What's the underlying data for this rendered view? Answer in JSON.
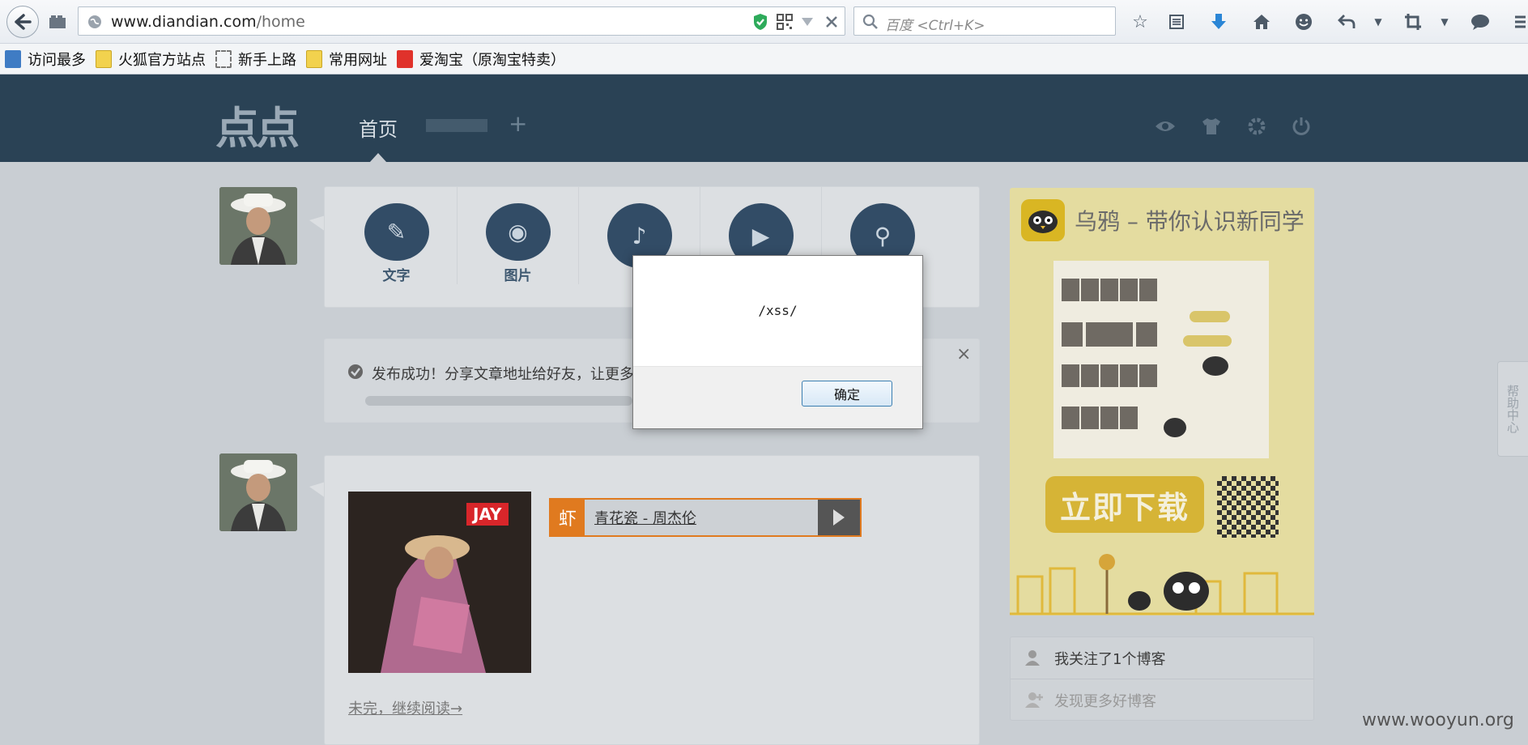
{
  "browser": {
    "url_host": "www.diandian.com",
    "url_path": "/home",
    "search_placeholder": "百度 <Ctrl+K>",
    "bookmarks": [
      {
        "label": "访问最多",
        "icon": "search-folder-icon"
      },
      {
        "label": "火狐官方站点",
        "icon": "folder-icon"
      },
      {
        "label": "新手上路",
        "icon": "dashed-folder-icon"
      },
      {
        "label": "常用网址",
        "icon": "folder-icon"
      },
      {
        "label": "爱淘宝（原淘宝特卖）",
        "icon": "taobao-icon"
      }
    ]
  },
  "site": {
    "logo": "点点",
    "nav_home": "首页",
    "nav_add": "+"
  },
  "composer": {
    "buttons": [
      {
        "label": "文字",
        "icon": "pen-icon"
      },
      {
        "label": "图片",
        "icon": "camera-icon"
      },
      {
        "label": "",
        "icon": "microphone-icon"
      },
      {
        "label": "",
        "icon": "clapper-icon"
      },
      {
        "label": "",
        "icon": "link-icon"
      }
    ]
  },
  "notice": {
    "text": "发布成功！分享文章地址给好友，让更多",
    "close": "×"
  },
  "post": {
    "music_tag": "虾",
    "song": "青花瓷 - 周杰伦",
    "cover_tag": "JAY",
    "read_more": "未完，继续阅读→"
  },
  "dialog": {
    "message": "/xss/",
    "ok_label": "确定"
  },
  "sidebar": {
    "ad_title": "乌鸦 – 带你认识新同学",
    "ad_download": "立即下载",
    "follow_text": "我关注了1个博客",
    "discover_text": "发现更多好博客",
    "help_tab": "帮助中心"
  },
  "watermark": "www.wooyun.org",
  "colors": {
    "header_bg": "#2a4255",
    "accent_orange": "#e07a1f",
    "ad_bg": "#e4dca0"
  }
}
